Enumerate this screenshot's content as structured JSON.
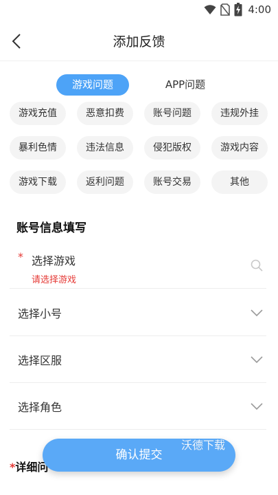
{
  "status_bar": {
    "time": "4:00"
  },
  "nav": {
    "title": "添加反馈"
  },
  "tabs": [
    {
      "label": "游戏问题",
      "active": true
    },
    {
      "label": "APP问题",
      "active": false
    }
  ],
  "categories": [
    "游戏充值",
    "恶意扣费",
    "账号问题",
    "违规外挂",
    "暴利色情",
    "违法信息",
    "侵犯版权",
    "游戏内容",
    "游戏下载",
    "返利问题",
    "账号交易",
    "其他"
  ],
  "account_section": {
    "title": "账号信息填写"
  },
  "form": {
    "select_game": {
      "required_mark": "*",
      "label": "选择游戏",
      "error": "请选择游戏"
    },
    "select_account": {
      "label": "选择小号"
    },
    "select_server": {
      "label": "选择区服"
    },
    "select_role": {
      "label": "选择角色"
    }
  },
  "detail_section": {
    "required_mark": "*",
    "title": "详细问"
  },
  "submit": {
    "label": "确认提交"
  },
  "watermark": {
    "text": "沃德下载"
  },
  "colors": {
    "accent": "#4da3f7",
    "error": "#e53935",
    "chip_bg": "#f4f4f4"
  }
}
